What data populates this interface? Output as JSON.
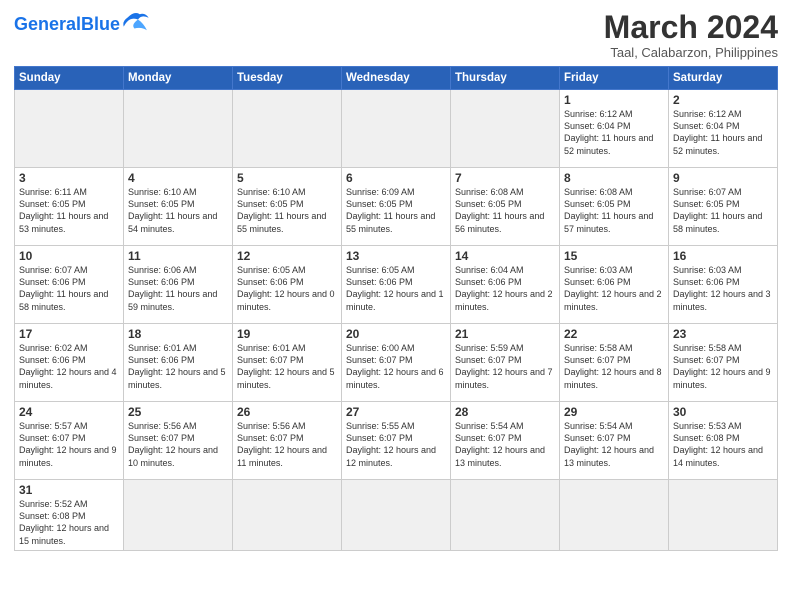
{
  "logo": {
    "text_general": "General",
    "text_blue": "Blue"
  },
  "header": {
    "month_year": "March 2024",
    "location": "Taal, Calabarzon, Philippines"
  },
  "weekdays": [
    "Sunday",
    "Monday",
    "Tuesday",
    "Wednesday",
    "Thursday",
    "Friday",
    "Saturday"
  ],
  "weeks": [
    [
      {
        "day": "",
        "info": ""
      },
      {
        "day": "",
        "info": ""
      },
      {
        "day": "",
        "info": ""
      },
      {
        "day": "",
        "info": ""
      },
      {
        "day": "",
        "info": ""
      },
      {
        "day": "1",
        "info": "Sunrise: 6:12 AM\nSunset: 6:04 PM\nDaylight: 11 hours\nand 52 minutes."
      },
      {
        "day": "2",
        "info": "Sunrise: 6:12 AM\nSunset: 6:04 PM\nDaylight: 11 hours\nand 52 minutes."
      }
    ],
    [
      {
        "day": "3",
        "info": "Sunrise: 6:11 AM\nSunset: 6:05 PM\nDaylight: 11 hours\nand 53 minutes."
      },
      {
        "day": "4",
        "info": "Sunrise: 6:10 AM\nSunset: 6:05 PM\nDaylight: 11 hours\nand 54 minutes."
      },
      {
        "day": "5",
        "info": "Sunrise: 6:10 AM\nSunset: 6:05 PM\nDaylight: 11 hours\nand 55 minutes."
      },
      {
        "day": "6",
        "info": "Sunrise: 6:09 AM\nSunset: 6:05 PM\nDaylight: 11 hours\nand 55 minutes."
      },
      {
        "day": "7",
        "info": "Sunrise: 6:08 AM\nSunset: 6:05 PM\nDaylight: 11 hours\nand 56 minutes."
      },
      {
        "day": "8",
        "info": "Sunrise: 6:08 AM\nSunset: 6:05 PM\nDaylight: 11 hours\nand 57 minutes."
      },
      {
        "day": "9",
        "info": "Sunrise: 6:07 AM\nSunset: 6:05 PM\nDaylight: 11 hours\nand 58 minutes."
      }
    ],
    [
      {
        "day": "10",
        "info": "Sunrise: 6:07 AM\nSunset: 6:06 PM\nDaylight: 11 hours\nand 58 minutes."
      },
      {
        "day": "11",
        "info": "Sunrise: 6:06 AM\nSunset: 6:06 PM\nDaylight: 11 hours\nand 59 minutes."
      },
      {
        "day": "12",
        "info": "Sunrise: 6:05 AM\nSunset: 6:06 PM\nDaylight: 12 hours\nand 0 minutes."
      },
      {
        "day": "13",
        "info": "Sunrise: 6:05 AM\nSunset: 6:06 PM\nDaylight: 12 hours\nand 1 minute."
      },
      {
        "day": "14",
        "info": "Sunrise: 6:04 AM\nSunset: 6:06 PM\nDaylight: 12 hours\nand 2 minutes."
      },
      {
        "day": "15",
        "info": "Sunrise: 6:03 AM\nSunset: 6:06 PM\nDaylight: 12 hours\nand 2 minutes."
      },
      {
        "day": "16",
        "info": "Sunrise: 6:03 AM\nSunset: 6:06 PM\nDaylight: 12 hours\nand 3 minutes."
      }
    ],
    [
      {
        "day": "17",
        "info": "Sunrise: 6:02 AM\nSunset: 6:06 PM\nDaylight: 12 hours\nand 4 minutes."
      },
      {
        "day": "18",
        "info": "Sunrise: 6:01 AM\nSunset: 6:06 PM\nDaylight: 12 hours\nand 5 minutes."
      },
      {
        "day": "19",
        "info": "Sunrise: 6:01 AM\nSunset: 6:07 PM\nDaylight: 12 hours\nand 5 minutes."
      },
      {
        "day": "20",
        "info": "Sunrise: 6:00 AM\nSunset: 6:07 PM\nDaylight: 12 hours\nand 6 minutes."
      },
      {
        "day": "21",
        "info": "Sunrise: 5:59 AM\nSunset: 6:07 PM\nDaylight: 12 hours\nand 7 minutes."
      },
      {
        "day": "22",
        "info": "Sunrise: 5:58 AM\nSunset: 6:07 PM\nDaylight: 12 hours\nand 8 minutes."
      },
      {
        "day": "23",
        "info": "Sunrise: 5:58 AM\nSunset: 6:07 PM\nDaylight: 12 hours\nand 9 minutes."
      }
    ],
    [
      {
        "day": "24",
        "info": "Sunrise: 5:57 AM\nSunset: 6:07 PM\nDaylight: 12 hours\nand 9 minutes."
      },
      {
        "day": "25",
        "info": "Sunrise: 5:56 AM\nSunset: 6:07 PM\nDaylight: 12 hours\nand 10 minutes."
      },
      {
        "day": "26",
        "info": "Sunrise: 5:56 AM\nSunset: 6:07 PM\nDaylight: 12 hours\nand 11 minutes."
      },
      {
        "day": "27",
        "info": "Sunrise: 5:55 AM\nSunset: 6:07 PM\nDaylight: 12 hours\nand 12 minutes."
      },
      {
        "day": "28",
        "info": "Sunrise: 5:54 AM\nSunset: 6:07 PM\nDaylight: 12 hours\nand 13 minutes."
      },
      {
        "day": "29",
        "info": "Sunrise: 5:54 AM\nSunset: 6:07 PM\nDaylight: 12 hours\nand 13 minutes."
      },
      {
        "day": "30",
        "info": "Sunrise: 5:53 AM\nSunset: 6:08 PM\nDaylight: 12 hours\nand 14 minutes."
      }
    ],
    [
      {
        "day": "31",
        "info": "Sunrise: 5:52 AM\nSunset: 6:08 PM\nDaylight: 12 hours\nand 15 minutes."
      },
      {
        "day": "",
        "info": ""
      },
      {
        "day": "",
        "info": ""
      },
      {
        "day": "",
        "info": ""
      },
      {
        "day": "",
        "info": ""
      },
      {
        "day": "",
        "info": ""
      },
      {
        "day": "",
        "info": ""
      }
    ]
  ]
}
